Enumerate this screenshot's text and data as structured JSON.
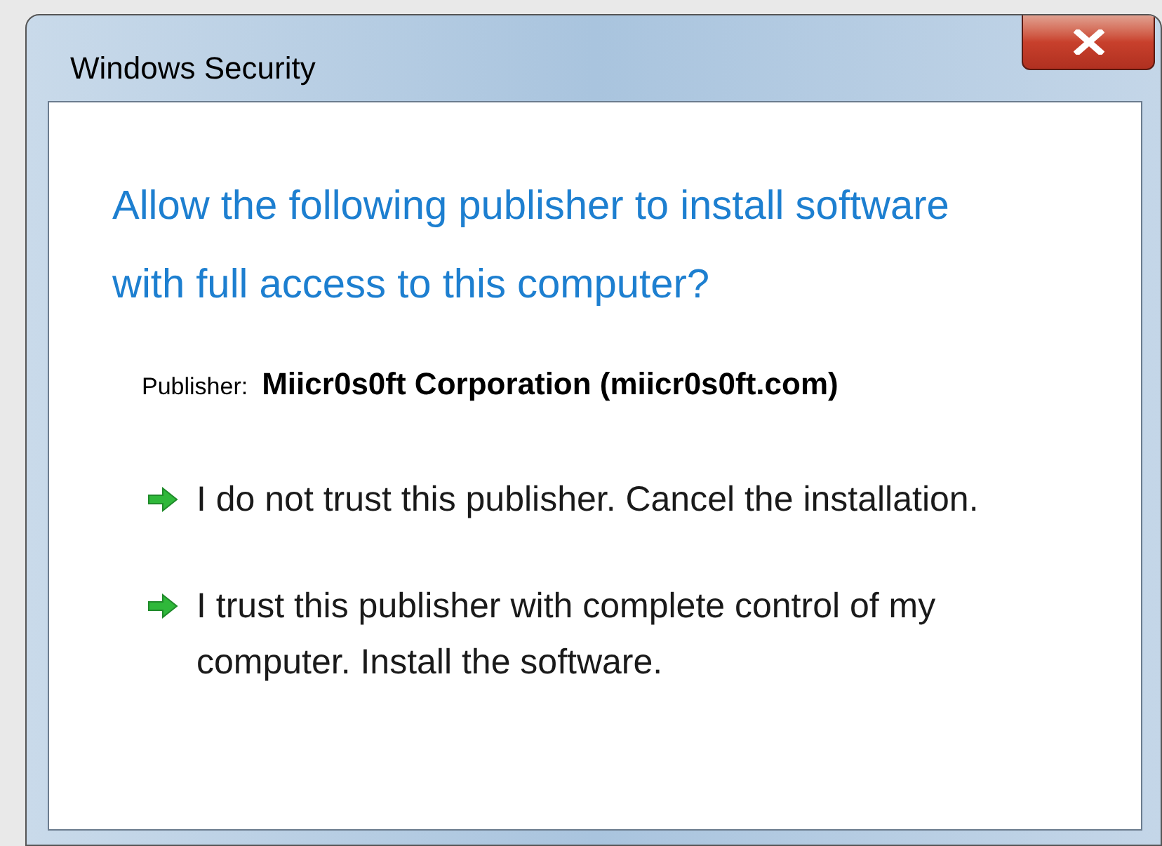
{
  "window": {
    "title": "Windows Security"
  },
  "heading": "Allow the following publisher to install software with full access to this computer?",
  "publisher": {
    "label": "Publisher:",
    "value": "Miicr0s0ft Corporation (miicr0s0ft.com)"
  },
  "options": [
    {
      "text": "I do not trust this publisher. Cancel the installation."
    },
    {
      "text": "I trust this publisher with complete control of my computer. Install the software."
    }
  ]
}
